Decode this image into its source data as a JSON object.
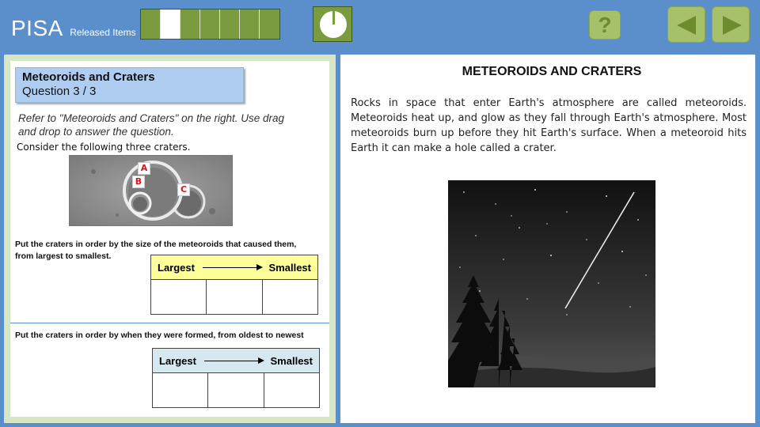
{
  "header": {
    "brand": "PISA",
    "subtitle": "Released Items",
    "progress": {
      "total": 7,
      "current": 2
    },
    "help_label": "?"
  },
  "question": {
    "title": "Meteoroids and Craters",
    "number": "Question 3 / 3",
    "instruction": "Refer to \"Meteoroids and Craters\" on the right. Use drag and drop to answer the question.",
    "consider": "Consider the following three craters.",
    "crater_labels": [
      "A",
      "B",
      "C"
    ],
    "prompt1": "Put the craters in order by the size of the meteoroids that caused them, from largest to smallest.",
    "prompt2": "Put the craters in order by when they were formed, from oldest to newest",
    "table1": {
      "left": "Largest",
      "right": "Smallest",
      "color": "#ffff99"
    },
    "table2": {
      "left": "Largest",
      "right": "Smallest",
      "color": "#d5e8f0"
    }
  },
  "stimulus": {
    "title": "METEOROIDS AND CRATERS",
    "text": "Rocks in space that enter Earth's atmosphere are called meteoroids. Meteoroids heat up, and glow as they fall through Earth's atmosphere. Most meteoroids burn up before they hit Earth's surface. When a meteoroid hits Earth it can make a hole called a crater."
  },
  "colors": {
    "topbar": "#5b8fcb",
    "button": "#a7c06a",
    "progress_fill": "#7a9c3e",
    "label_text": "#dd1122"
  }
}
